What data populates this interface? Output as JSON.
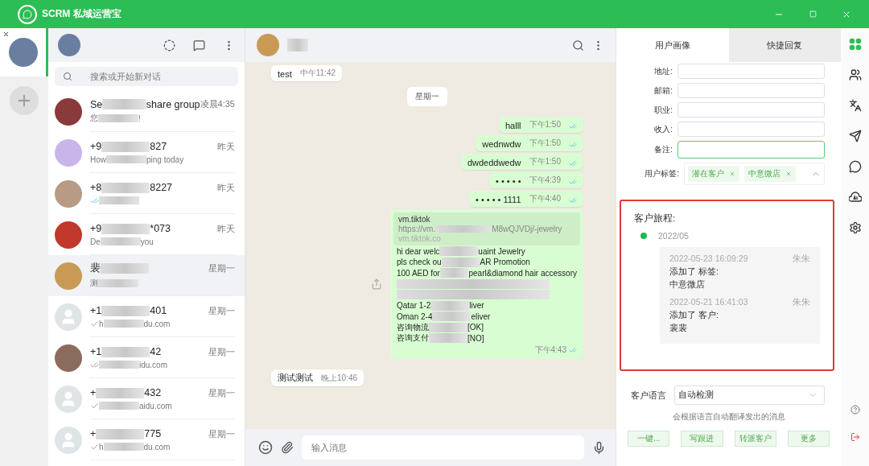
{
  "app": {
    "title": "SCRM 私域运营宝"
  },
  "search": {
    "placeholder": "搜索或开始新对话"
  },
  "chats": [
    {
      "name": {
        "a": "Se",
        "b": "share group"
      },
      "preview": {
        "a": "您",
        "b": "!"
      },
      "time": "凌晨4:35",
      "kind": "photo",
      "selected": false
    },
    {
      "name": {
        "a": "+9",
        "b": "827"
      },
      "preview": {
        "a": "How",
        "b": "ping today"
      },
      "time": "昨天",
      "kind": "photo",
      "selected": false
    },
    {
      "name": {
        "a": "+8",
        "b": "8227"
      },
      "check": true,
      "double": true,
      "read": true,
      "time": "昨天",
      "kind": "photo",
      "selected": false
    },
    {
      "name": {
        "a": "+9",
        "b": "*073"
      },
      "preview": {
        "a": "De",
        "b": "you"
      },
      "time": "昨天",
      "kind": "photo",
      "selected": false
    },
    {
      "name": {
        "a": "裴"
      },
      "preview": {
        "a": "测"
      },
      "time": "星期一",
      "kind": "photo",
      "selected": true
    },
    {
      "name": {
        "a": "+1",
        "b": "401"
      },
      "preview": {
        "a": "h",
        "b": "du.com"
      },
      "check": true,
      "double": false,
      "read": false,
      "time": "星期一",
      "kind": "default",
      "selected": false
    },
    {
      "name": {
        "a": "+1",
        "b": "42"
      },
      "preview": {
        "b": "idu.com"
      },
      "check": true,
      "double": true,
      "read": false,
      "time": "星期一",
      "kind": "photo",
      "selected": false
    },
    {
      "name": {
        "a": "+",
        "b": "432"
      },
      "preview": {
        "b": "aidu.com"
      },
      "check": true,
      "double": false,
      "read": false,
      "time": "星期一",
      "kind": "default",
      "selected": false
    },
    {
      "name": {
        "a": "+",
        "b": "775"
      },
      "preview": {
        "a": "h",
        "b": "du.com"
      },
      "check": true,
      "double": false,
      "read": false,
      "time": "星期一",
      "kind": "default",
      "selected": false
    }
  ],
  "messages": [
    {
      "kind": "incoming",
      "text": "test",
      "time": "中午11:42"
    },
    {
      "kind": "date",
      "text": "星期一"
    },
    {
      "kind": "outgoing",
      "text": "halll",
      "time": "下午1:50"
    },
    {
      "kind": "outgoing",
      "text": "wednwdw",
      "time": "下午1:50"
    },
    {
      "kind": "outgoing",
      "text": "dwdeddwedw",
      "time": "下午1:50"
    },
    {
      "kind": "outgoing",
      "text": "• • • • •",
      "time": "下午4:39"
    },
    {
      "kind": "outgoing",
      "text": "• • • • • 1111",
      "time": "下午4:40"
    },
    {
      "kind": "link",
      "preview_title": "vm.tiktok",
      "preview_url": [
        "https://vm.",
        "M8wQJVDj/-jewelry"
      ],
      "preview_site": "vm.tiktok.co",
      "lines": [
        {
          "kind": "text",
          "a": "hi dear welc",
          "b": "uaint Jewelry"
        },
        {
          "kind": "text",
          "a": "pls check ou",
          "b": "AR Promotion"
        },
        {
          "kind": "text",
          "a": "100 AED for",
          "b": "pearl&diamond hair accessory"
        },
        {
          "kind": "blurred"
        },
        {
          "kind": "blurred"
        },
        {
          "kind": "text",
          "a": "Qatar 1-2",
          "b": "liver"
        },
        {
          "kind": "text",
          "a": "Oman 2-4",
          "b": "eliver"
        },
        {
          "kind": "text",
          "a": "咨询物流",
          "b": "[OK]"
        },
        {
          "kind": "text",
          "a": "咨询支付",
          "b": "[NO]"
        }
      ],
      "time": "下午4:43"
    },
    {
      "kind": "incoming",
      "text": "测试测试",
      "time": "晚上10:46"
    }
  ],
  "composer": {
    "placeholder": "输入消息"
  },
  "panel": {
    "tabs": [
      {
        "label": "用户画像",
        "selected": true
      },
      {
        "label": "快捷回复",
        "selected": false
      }
    ],
    "fields": [
      {
        "label": "地址:",
        "focused": false
      },
      {
        "label": "邮箱:",
        "focused": false
      },
      {
        "label": "职业:",
        "focused": false
      },
      {
        "label": "收入:",
        "focused": false
      },
      {
        "label": "备注:",
        "focused": true
      }
    ],
    "tags_label": "用户标签:",
    "tags": [
      "潜在客户",
      "中意微店"
    ],
    "journey": {
      "title": "客户旅程:",
      "month": "2022/05",
      "entries": [
        {
          "time": "2022-05-23 16:09:29",
          "user": "朱朱",
          "action": "添加了 标签:",
          "value": "中意微店"
        },
        {
          "time": "2022-05-21 16:41:03",
          "user": "朱朱",
          "action": "添加了 客户:",
          "value": "裴裴"
        }
      ]
    },
    "language_label": "客户语言",
    "language": "自动检测",
    "language_hint": "会根据语言自动翻译发出的消息",
    "buttons": [
      "一键...",
      "写跟进",
      "转派客户",
      "更多"
    ]
  }
}
